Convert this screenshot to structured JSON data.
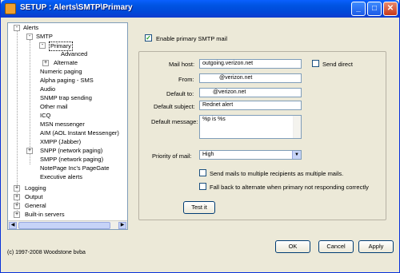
{
  "window": {
    "title": "SETUP : Alerts\\SMTP\\Primary",
    "minimize_glyph": "_",
    "maximize_glyph": "□",
    "close_glyph": "✕"
  },
  "tree": {
    "items": [
      {
        "label": "Alerts",
        "expander": "-"
      },
      {
        "label": "SMTP",
        "expander": "-"
      },
      {
        "label": "Primary",
        "expander": "-"
      },
      {
        "label": "Advanced"
      },
      {
        "label": "Alternate",
        "expander": "+"
      },
      {
        "label": "Numeric paging"
      },
      {
        "label": "Alpha paging - SMS"
      },
      {
        "label": "Audio"
      },
      {
        "label": "SNMP trap sending"
      },
      {
        "label": "Other mail"
      },
      {
        "label": "ICQ"
      },
      {
        "label": "MSN messenger"
      },
      {
        "label": "AIM (AOL Instant Messenger)"
      },
      {
        "label": "XMPP (Jabber)"
      },
      {
        "label": "SNPP (network paging)",
        "expander": "+"
      },
      {
        "label": "SMPP (network paging)"
      },
      {
        "label": "NotePage Inc's PageGate"
      },
      {
        "label": "Executive alerts"
      },
      {
        "label": "Logging",
        "expander": "+"
      },
      {
        "label": "Output",
        "expander": "+"
      },
      {
        "label": "General",
        "expander": "+"
      },
      {
        "label": "Built-in servers",
        "expander": "+"
      }
    ],
    "scroll_left": "◀",
    "scroll_right": "▶"
  },
  "form": {
    "enable_label": "Enable primary SMTP mail",
    "enable_checked": "✓",
    "mail_host_label": "Mail host:",
    "mail_host_value": "outgoing.verizon.net",
    "send_direct_label": "Send direct",
    "from_label": "From:",
    "from_value": "@verizon.net",
    "default_to_label": "Default to:",
    "default_to_value": "@verizon.net",
    "default_subject_label": "Default subject:",
    "default_subject_value": "Rednet alert",
    "default_message_label": "Default message:",
    "default_message_value": "%p is %s",
    "priority_label": "Priority of mail:",
    "priority_value": "High",
    "priority_arrow": "▼",
    "multi_recipients_label": "Send mails to multiple recipients as multiple mails.",
    "fallback_label": "Fall back to alternate when primary not responding correctly",
    "test_button": "Test it"
  },
  "footer": {
    "copyright": "(c) 1997-2008 Woodstone bvba",
    "ok": "OK",
    "cancel": "Cancel",
    "apply": "Apply"
  },
  "colors": {
    "title_bar": "#0054e3",
    "window_bg": "#ece9d8",
    "check_green": "#21a121"
  }
}
